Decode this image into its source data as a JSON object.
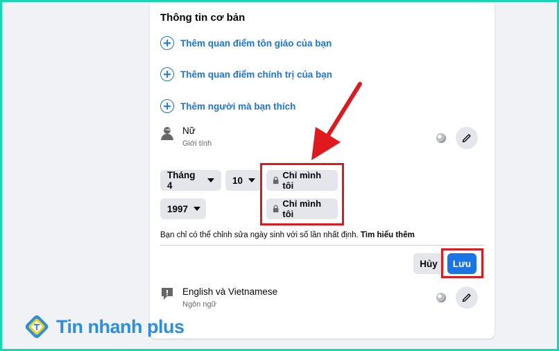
{
  "section": {
    "title": "Thông tin cơ bản"
  },
  "add_links": [
    {
      "label": "Thêm quan điểm tôn giáo của bạn"
    },
    {
      "label": "Thêm quan điểm chính trị của bạn"
    },
    {
      "label": "Thêm người mà bạn thích"
    }
  ],
  "gender": {
    "value": "Nữ",
    "caption": "Giới tính"
  },
  "birthday": {
    "month": "Tháng 4",
    "day": "10",
    "year": "1997",
    "privacy_date": "Chỉ mình tôi",
    "privacy_year": "Chỉ mình tôi",
    "note": "Bạn chỉ có thể chỉnh sửa ngày sinh với số lần nhất định.",
    "learn_more": "Tìm hiểu thêm"
  },
  "actions": {
    "cancel_label": "Hủy",
    "save_label": "Lưu"
  },
  "language": {
    "value": "English và Vietnamese",
    "caption": "Ngôn ngữ"
  },
  "watermark": {
    "text": "Tin nhanh plus"
  },
  "colors": {
    "accent": "#1b74e4",
    "highlight": "#e0191f",
    "border": "#16d6b3"
  }
}
